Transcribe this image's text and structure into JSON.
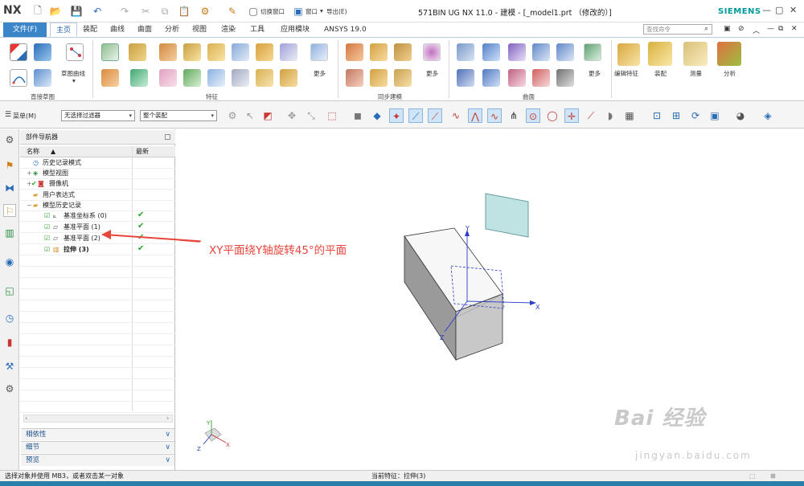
{
  "app": {
    "logo": "NX",
    "window_title": "571BIN UG NX 11.0 - 建模 - [_model1.prt （修改的）]",
    "brand": "SIEMENS",
    "switch_window": "切换窗口",
    "window_menu": "窗口",
    "export_menu": "导出(E)"
  },
  "tabs": [
    "主页",
    "装配",
    "曲线",
    "曲面",
    "分析",
    "视图",
    "渲染",
    "工具",
    "应用模块",
    "ANSYS 19.0"
  ],
  "file_tab": "文件(F)",
  "command_search": {
    "placeholder": "查找命令"
  },
  "ribbon": {
    "sketch_curve": "草图曲线",
    "groups": [
      "直接草图",
      "特征",
      "同步建模",
      "曲面"
    ],
    "more": "更多",
    "edit_feature": "编辑特征",
    "assembly": "装配",
    "measure": "测量",
    "analysis": "分析"
  },
  "toolbar2": {
    "menu": "菜单(M)",
    "filter": "无选择过滤器",
    "scope": "整个装配"
  },
  "navigator": {
    "title": "部件导航器",
    "col_name": "名称",
    "col_latest": "最新",
    "rows": [
      {
        "label": "历史记录模式",
        "indent": 0,
        "latest": ""
      },
      {
        "label": "模型视图",
        "indent": 0,
        "latest": ""
      },
      {
        "label": "摄像机",
        "indent": 0,
        "latest": ""
      },
      {
        "label": "用户表达式",
        "indent": 0,
        "latest": ""
      },
      {
        "label": "模型历史记录",
        "indent": 0,
        "latest": ""
      },
      {
        "label": "基准坐标系 (0)",
        "indent": 1,
        "latest": "✔"
      },
      {
        "label": "基准平面 (1)",
        "indent": 1,
        "latest": "✔"
      },
      {
        "label": "基准平面 (2)",
        "indent": 1,
        "latest": "✔"
      },
      {
        "label": "拉伸 (3)",
        "indent": 1,
        "latest": "✔"
      }
    ],
    "accordion": [
      "相依性",
      "细节",
      "预览"
    ]
  },
  "annotation": "XY平面绕Y轴旋转45°的平面",
  "axes": {
    "x": "X",
    "y": "Y",
    "z": "Z"
  },
  "status": {
    "left": "选择对象并使用 MB3，或者双击某一对象",
    "current_feature": "当前特征：拉伸(3)"
  },
  "watermark": {
    "main": "Bai 经验",
    "sub": "jingyan.baidu.com"
  },
  "colors": {
    "accent": "#3a86c8",
    "annotation": "#e8453c",
    "check": "#2e9e2e",
    "datum_plane": "#bfe3e3"
  }
}
